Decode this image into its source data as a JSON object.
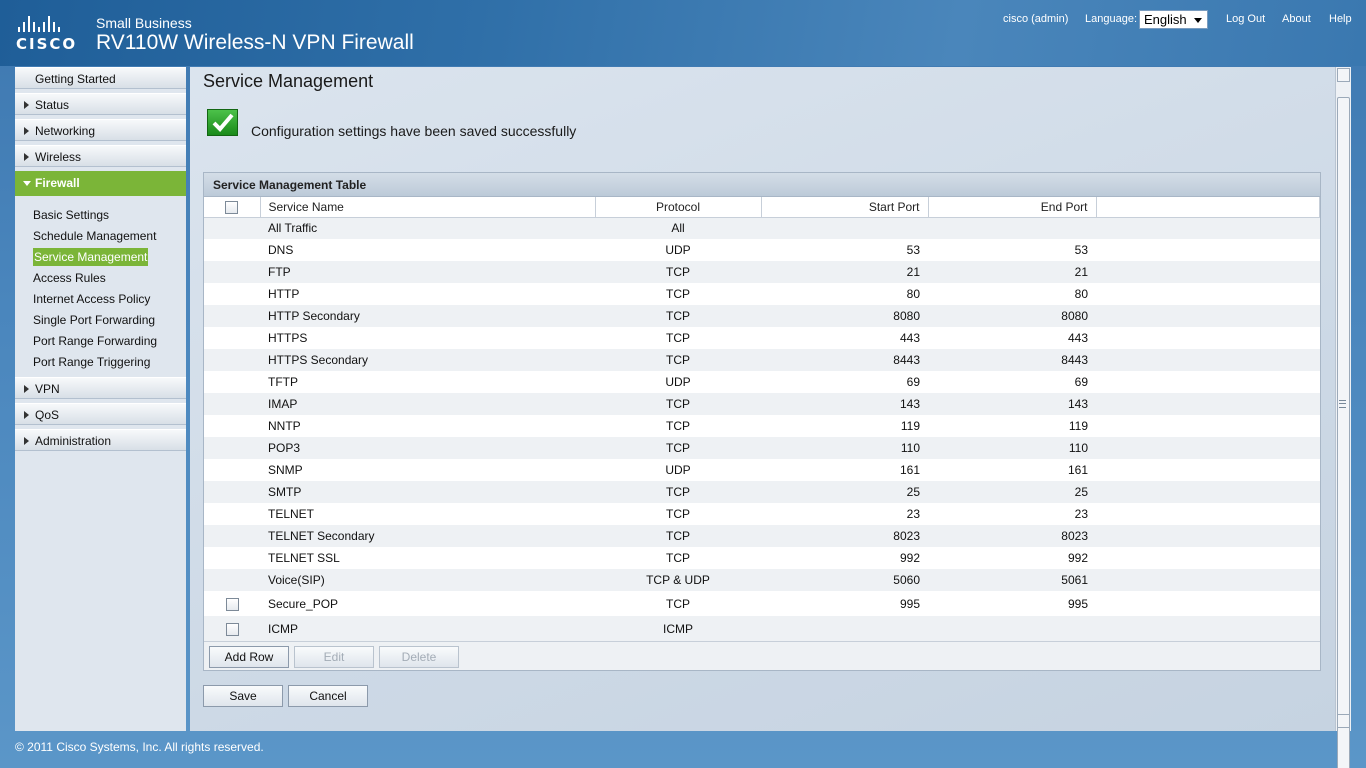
{
  "header": {
    "logo_word": "CISCO",
    "brand_small": "Small Business",
    "product_title": "RV110W Wireless-N VPN Firewall",
    "user": "cisco (admin)",
    "language_label": "Language:",
    "language_value": "English",
    "logout": "Log Out",
    "about": "About",
    "help": "Help"
  },
  "sidebar": {
    "getting_started": "Getting Started",
    "status": "Status",
    "networking": "Networking",
    "wireless": "Wireless",
    "firewall": "Firewall",
    "firewall_items": [
      "Basic Settings",
      "Schedule Management",
      "Service Management",
      "Access Rules",
      "Internet Access Policy",
      "Single Port Forwarding",
      "Port Range Forwarding",
      "Port Range Triggering"
    ],
    "vpn": "VPN",
    "qos": "QoS",
    "administration": "Administration"
  },
  "main": {
    "title": "Service Management",
    "success_message": "Configuration settings have been saved successfully",
    "table_caption": "Service Management Table",
    "columns": [
      "Service Name",
      "Protocol",
      "Start Port",
      "End Port"
    ],
    "rows": [
      {
        "name": "All Traffic",
        "protocol": "All",
        "start": "",
        "end": "",
        "checkbox": false
      },
      {
        "name": "DNS",
        "protocol": "UDP",
        "start": "53",
        "end": "53",
        "checkbox": false
      },
      {
        "name": "FTP",
        "protocol": "TCP",
        "start": "21",
        "end": "21",
        "checkbox": false
      },
      {
        "name": "HTTP",
        "protocol": "TCP",
        "start": "80",
        "end": "80",
        "checkbox": false
      },
      {
        "name": "HTTP Secondary",
        "protocol": "TCP",
        "start": "8080",
        "end": "8080",
        "checkbox": false
      },
      {
        "name": "HTTPS",
        "protocol": "TCP",
        "start": "443",
        "end": "443",
        "checkbox": false
      },
      {
        "name": "HTTPS Secondary",
        "protocol": "TCP",
        "start": "8443",
        "end": "8443",
        "checkbox": false
      },
      {
        "name": "TFTP",
        "protocol": "UDP",
        "start": "69",
        "end": "69",
        "checkbox": false
      },
      {
        "name": "IMAP",
        "protocol": "TCP",
        "start": "143",
        "end": "143",
        "checkbox": false
      },
      {
        "name": "NNTP",
        "protocol": "TCP",
        "start": "119",
        "end": "119",
        "checkbox": false
      },
      {
        "name": "POP3",
        "protocol": "TCP",
        "start": "110",
        "end": "110",
        "checkbox": false
      },
      {
        "name": "SNMP",
        "protocol": "UDP",
        "start": "161",
        "end": "161",
        "checkbox": false
      },
      {
        "name": "SMTP",
        "protocol": "TCP",
        "start": "25",
        "end": "25",
        "checkbox": false
      },
      {
        "name": "TELNET",
        "protocol": "TCP",
        "start": "23",
        "end": "23",
        "checkbox": false
      },
      {
        "name": "TELNET Secondary",
        "protocol": "TCP",
        "start": "8023",
        "end": "8023",
        "checkbox": false
      },
      {
        "name": "TELNET SSL",
        "protocol": "TCP",
        "start": "992",
        "end": "992",
        "checkbox": false
      },
      {
        "name": "Voice(SIP)",
        "protocol": "TCP & UDP",
        "start": "5060",
        "end": "5061",
        "checkbox": false
      },
      {
        "name": "Secure_POP",
        "protocol": "TCP",
        "start": "995",
        "end": "995",
        "checkbox": true
      },
      {
        "name": "ICMP",
        "protocol": "ICMP",
        "start": "",
        "end": "",
        "checkbox": true
      }
    ],
    "add_row": "Add Row",
    "edit": "Edit",
    "delete": "Delete",
    "save": "Save",
    "cancel": "Cancel"
  },
  "footer": "© 2011 Cisco Systems, Inc. All rights reserved.",
  "colors": {
    "accent_green": "#7bb538",
    "header_blue": "#2f6fa8"
  }
}
